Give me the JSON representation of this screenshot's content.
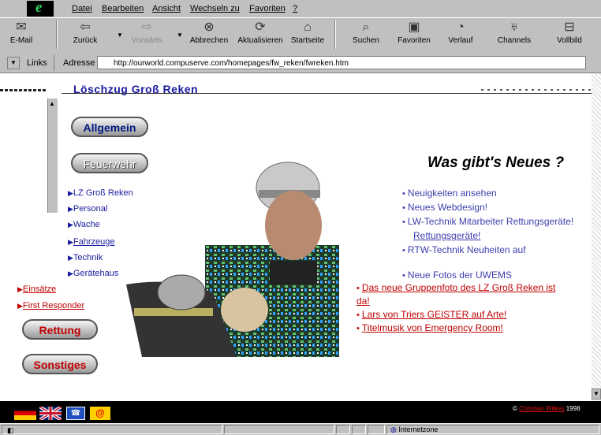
{
  "menu": {
    "items": [
      "Datei",
      "Bearbeiten",
      "Ansicht",
      "Wechseln zu",
      "Favoriten",
      "?"
    ]
  },
  "toolbar": {
    "email_label": "E-Mail",
    "back_label": "Zurück",
    "forward_label": "Vorwärts",
    "stop_label": "Abbrechen",
    "refresh_label": "Aktualisieren",
    "home_label": "Startseite",
    "search_label": "Suchen",
    "favorites_label": "Favoriten",
    "history_label": "Verlauf",
    "channels_label": "Channels",
    "fullscreen_label": "Vollbild"
  },
  "addressbar": {
    "links_label": "Links",
    "address_label": "Adresse",
    "url": "http://ourworld.compuserve.com/homepages/fw_reken/fwreken.htm"
  },
  "page": {
    "banner": "Löschzug Groß Reken",
    "nav": {
      "allgemein": "Allgemein",
      "feuerwehr": "Feuerwehr",
      "links_top": [
        "LZ Groß Reken",
        "Personal",
        "Wache",
        "Fahrzeuge",
        "Technik",
        "Gerätehaus"
      ],
      "einsaetze": "Einsätze",
      "first_responder": "First Responder",
      "rettung": "Rettung",
      "sonstiges": "Sonstiges"
    },
    "news": {
      "title": "Was gibt's Neues ?",
      "items_ghost": [
        "Neuigkeiten ansehen",
        "Neues Webdesign!",
        "LW-Technik Mitarbeiter Rettungsgeräte!",
        "RTW-Technik Neuheiten auf",
        "Neue Fotos der UWEMS"
      ],
      "item_rettungsgeraete": "Rettungsgeräte!",
      "item_gruppenfoto": "Das neue Gruppenfoto des LZ Groß Reken ist da!",
      "item_gruppenfoto_line2": "Reken ist da!",
      "item_geister": "Lars von Triers GEISTER auf Arte!",
      "item_titelmusik": "Titelmusik von Emergency Room!"
    }
  },
  "footer": {
    "copyright_symbol": "©",
    "author": "Christian Wilkes",
    "year": "1998"
  },
  "status": {
    "zone": "Internetzone"
  },
  "colors": {
    "chrome": "#c0c0c0",
    "link_red": "#c00000",
    "link_blue": "#1a1aa0"
  }
}
